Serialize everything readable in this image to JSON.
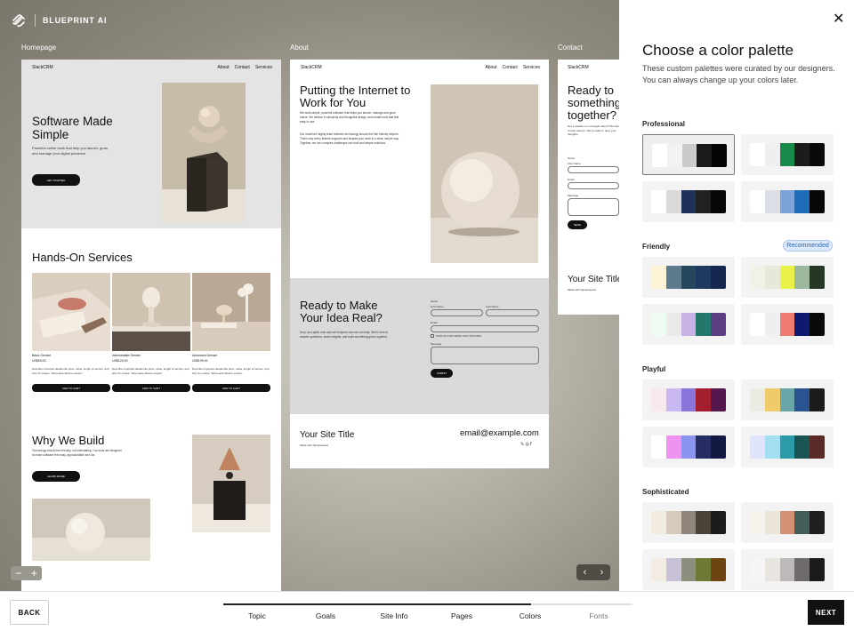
{
  "brand": {
    "name": "BLUEPRINT AI",
    "logo_icon": "blueprint-logo-icon"
  },
  "frames": [
    {
      "label": "Homepage"
    },
    {
      "label": "About"
    },
    {
      "label": "Contact"
    }
  ],
  "homepage": {
    "site": "SlackCRM",
    "nav": [
      "About",
      "Contact",
      "Services"
    ],
    "hero_title": "Software Made Simple",
    "hero_text": "Powerful online tools that help you launch, grow, and manage your digital presence.",
    "hero_cta": "GET STARTED",
    "services_title": "Hands-On Services",
    "services": [
      {
        "name": "Basic Service",
        "price": "US$99.00",
        "button": "ADD TO CART"
      },
      {
        "name": "Intermediate Service",
        "price": "US$129.00",
        "button": "ADD TO CART"
      },
      {
        "name": "Advanced Service",
        "price": "US$199.00",
        "button": "ADD TO CART"
      }
    ],
    "service_desc": "Describe important details like price, value, length of service, and why it's unique. Tell people what to expect.",
    "why_title": "Why We Build",
    "why_text": "Technology should feel friendly, not intimidating. Our tools are designed to make software feel easy, approachable and fun.",
    "why_cta": "LEARN MORE"
  },
  "about": {
    "site": "SlackCRM",
    "nav": [
      "About",
      "Contact",
      "Services"
    ],
    "title": "Putting the Internet to Work for You",
    "para1": "We build simple, powerful software that helps you launch, manage and grow online. We believe in simplicity and thoughtful design, and create tools that feel easy to use.",
    "para2": "Our small but mighty team believes technology should feel like friendly helpers. That's why every feature supports and shapes your work in a clear, simple way. Together, we turn complex challenges into bold and simple solutions.",
    "cta_title": "Ready to Make Your Idea Real?",
    "cta_text": "Drop us a quick note and we'll explore how we can help. We're here to answer questions, share insights, and build something great, together.",
    "form": {
      "name": "Name",
      "first": "First Name",
      "last": "Last Name",
      "email": "Email",
      "signup": "SIGN UP FOR NEWS AND UPDATES",
      "message": "Message",
      "required": "(required)",
      "submit": "SUBMIT"
    },
    "footer_title": "Your Site Title",
    "footer_email": "email@example.com",
    "footer_made": "Made with Squarespace"
  },
  "contact": {
    "site": "SlackCRM",
    "title": "Ready to something together?",
    "text": "Got a question or a thought about? We want to hear about it. We're ready to hear your thoughts.",
    "name": "Name",
    "first": "First Name",
    "email": "Email",
    "message": "Message",
    "send": "SEND",
    "footer_title": "Your Site Title",
    "footer_made": "Made with Squarespace"
  },
  "controls": {
    "zoom_out": "−",
    "zoom_in": "+",
    "prev": "‹",
    "next": "›"
  },
  "panel": {
    "close": "✕",
    "title": "Choose a color palette",
    "description": "These custom palettes were curated by our designers. You can always change up your colors later.",
    "sections": [
      {
        "title": "Professional",
        "badge": "",
        "palettes": [
          [
            "#ffffff",
            "#f2f2f2",
            "#cbcbcb",
            "#1a1a1a",
            "#050505"
          ],
          [
            "#ffffff",
            "#efefef",
            "#188a4a",
            "#1c1c1c",
            "#0a0a0a"
          ],
          [
            "#ffffff",
            "#dadada",
            "#203159",
            "#212121",
            "#060606"
          ],
          [
            "#ffffff",
            "#dcdfe6",
            "#7ea3d9",
            "#1f6cb8",
            "#060606"
          ]
        ]
      },
      {
        "title": "Friendly",
        "badge": "Recommended",
        "palettes": [
          [
            "#fbf3d6",
            "#5c7a8b",
            "#27485c",
            "#203a5f",
            "#172850"
          ],
          [
            "#f1f1e8",
            "#e7e8da",
            "#e9f24b",
            "#9cb79b",
            "#243624"
          ],
          [
            "#eefaf2",
            "#eaeaea",
            "#c8b3e6",
            "#23776b",
            "#5b3d82"
          ],
          [
            "#ffffff",
            "#efefef",
            "#ee7c70",
            "#101970",
            "#090909"
          ]
        ]
      },
      {
        "title": "Playful",
        "badge": "",
        "palettes": [
          [
            "#f8e9ee",
            "#c9b8f2",
            "#8a76db",
            "#a31f2e",
            "#55174d"
          ],
          [
            "#ecebe3",
            "#efcc69",
            "#6aa6a7",
            "#2a5490",
            "#1c1c1c"
          ],
          [
            "#ffffff",
            "#ef93f0",
            "#8b94ee",
            "#252d62",
            "#121a43"
          ],
          [
            "#e0e5fb",
            "#a3dff0",
            "#2d9ba7",
            "#1a5554",
            "#5a2a27"
          ]
        ]
      },
      {
        "title": "Sophisticated",
        "badge": "",
        "palettes": [
          [
            "#f1ebe0",
            "#d8cbbb",
            "#8f857a",
            "#4a4236",
            "#1c1c1c"
          ],
          [
            "#f6f3ed",
            "#ece6da",
            "#d29074",
            "#435d58",
            "#1f1f1f"
          ],
          [
            "#f2ece3",
            "#c8c1d8",
            "#8c8f7e",
            "#6e7a34",
            "#6e4412"
          ],
          [
            "#f5f5f5",
            "#e8e4e0",
            "#bdb9b8",
            "#6f6b6c",
            "#1a1a1a"
          ]
        ]
      }
    ]
  },
  "bottom": {
    "back": "BACK",
    "next": "NEXT",
    "steps": [
      "Topic",
      "Goals",
      "Site Info",
      "Pages",
      "Colors",
      "Fonts"
    ]
  }
}
